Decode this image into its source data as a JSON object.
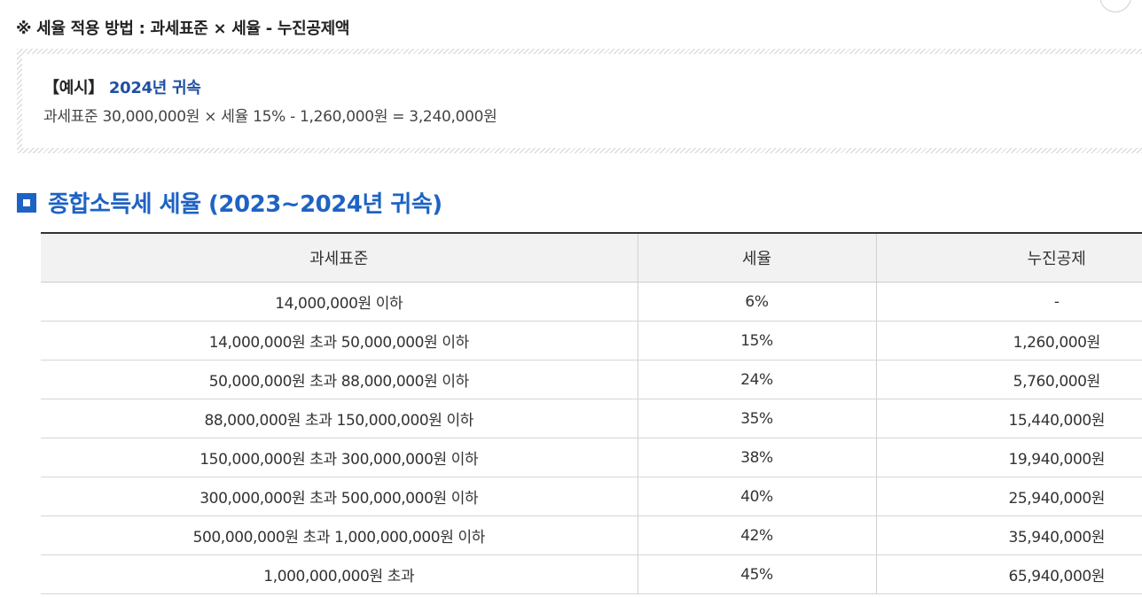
{
  "formula": "※ 세율 적용 방법 : 과세표준 × 세율 - 누진공제액",
  "example": {
    "bracket": "【예시】",
    "year_label": "2024년 귀속",
    "calculation": "과세표준 30,000,000원 × 세율 15% - 1,260,000원 = 3,240,000원"
  },
  "section": {
    "title": "종합소득세 세율 (2023~2024년 귀속)",
    "icon": "square-bullet-icon"
  },
  "table": {
    "headers": [
      "과세표준",
      "세율",
      "누진공제"
    ],
    "rows": [
      {
        "base": "14,000,000원 이하",
        "rate": "6%",
        "deduction": "-"
      },
      {
        "base": "14,000,000원 초과 50,000,000원 이하",
        "rate": "15%",
        "deduction": "1,260,000원"
      },
      {
        "base": "50,000,000원 초과 88,000,000원 이하",
        "rate": "24%",
        "deduction": "5,760,000원"
      },
      {
        "base": "88,000,000원 초과 150,000,000원 이하",
        "rate": "35%",
        "deduction": "15,440,000원"
      },
      {
        "base": "150,000,000원 초과 300,000,000원 이하",
        "rate": "38%",
        "deduction": "19,940,000원"
      },
      {
        "base": "300,000,000원 초과 500,000,000원 이하",
        "rate": "40%",
        "deduction": "25,940,000원"
      },
      {
        "base": "500,000,000원 초과 1,000,000,000원 이하",
        "rate": "42%",
        "deduction": "35,940,000원"
      },
      {
        "base": "1,000,000,000원 초과",
        "rate": "45%",
        "deduction": "65,940,000원"
      }
    ]
  },
  "colors": {
    "accent": "#1e63c4",
    "year_text": "#1f4fa0",
    "header_bg": "#f2f2f2"
  }
}
